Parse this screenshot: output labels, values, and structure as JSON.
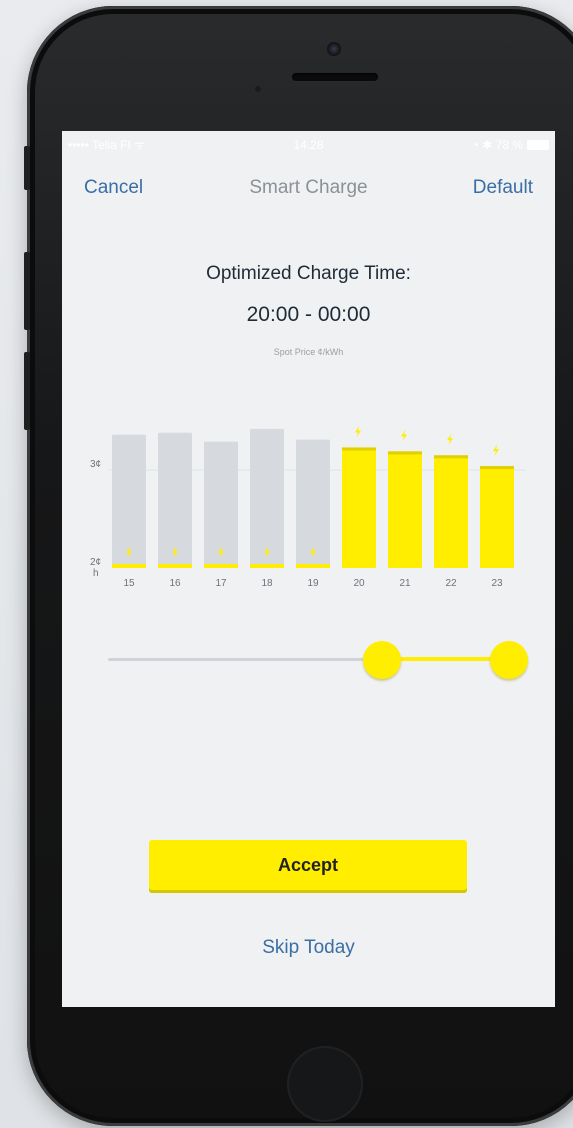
{
  "status_bar": {
    "carrier": "••••• Telia FI ᯤ",
    "time": "14.28",
    "battery_text": "◔ ✱ 78 %"
  },
  "nav": {
    "cancel": "Cancel",
    "title": "Smart Charge",
    "default": "Default"
  },
  "header": {
    "heading": "Optimized Charge Time:",
    "time_range": "20:00 - 00:00",
    "unit_label": "Spot Price ¢/kWh"
  },
  "chart_data": {
    "type": "bar",
    "categories": [
      "15",
      "16",
      "17",
      "18",
      "19",
      "20",
      "21",
      "22",
      "23"
    ],
    "values": [
      3.36,
      3.38,
      3.29,
      3.42,
      3.31,
      3.23,
      3.19,
      3.15,
      3.04
    ],
    "charging": [
      false,
      false,
      false,
      false,
      false,
      true,
      true,
      true,
      true
    ],
    "ylim": [
      2,
      3.5
    ],
    "yticks": [
      2,
      3
    ],
    "ytick_labels": [
      "2¢",
      "3¢"
    ],
    "xlabel": "h",
    "colors": {
      "inactive": "#d6d9de",
      "active": "#ffee00",
      "gridline": "#e2e5e8"
    }
  },
  "slider": {
    "start_hour": 20,
    "end_hour": 24,
    "min_hour": 15,
    "max_hour": 24
  },
  "actions": {
    "accept": "Accept",
    "skip": "Skip Today"
  },
  "colors": {
    "accent": "#ffee00",
    "link": "#3a6ea5",
    "text": "#1f2b37"
  }
}
